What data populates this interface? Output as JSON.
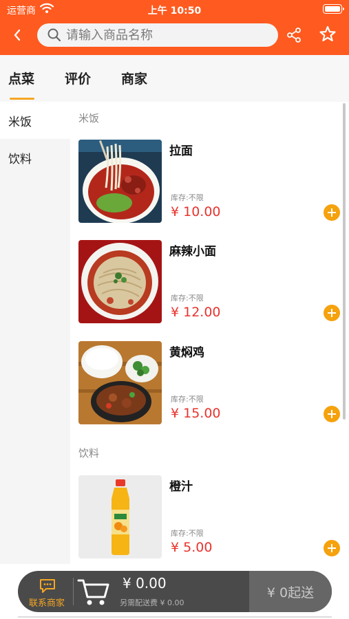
{
  "status_bar": {
    "carrier": "运营商",
    "time": "上午 10:50"
  },
  "search": {
    "placeholder": "请输入商品名称",
    "value": ""
  },
  "tabs": [
    {
      "label": "点菜",
      "active": true
    },
    {
      "label": "评价",
      "active": false
    },
    {
      "label": "商家",
      "active": false
    }
  ],
  "sidebar": {
    "items": [
      {
        "label": "米饭",
        "active": true
      },
      {
        "label": "饮料",
        "active": false
      }
    ]
  },
  "sections": [
    {
      "title": "米饭",
      "products": [
        {
          "name": "拉面",
          "stock": "库存:不限",
          "price": "¥ 10.00",
          "image": "beef-noodle-soup"
        },
        {
          "name": "麻辣小面",
          "stock": "库存:不限",
          "price": "¥ 12.00",
          "image": "spicy-noodles"
        },
        {
          "name": "黄焖鸡",
          "stock": "库存:不限",
          "price": "¥ 15.00",
          "image": "braised-chicken-rice"
        }
      ]
    },
    {
      "title": "饮料",
      "products": [
        {
          "name": "橙汁",
          "stock": "库存:不限",
          "price": "¥ 5.00",
          "image": "orange-juice-bottle"
        }
      ]
    }
  ],
  "cart": {
    "contact_label": "联系商家",
    "total": "¥ 0.00",
    "delivery_fee": "另需配送费 ¥ 0.00",
    "checkout_label": "¥ 0起送"
  },
  "colors": {
    "header": "#ff5a1f",
    "accent": "#f5a623",
    "price": "#e8332e",
    "cartbar": "#4a4a4a"
  }
}
